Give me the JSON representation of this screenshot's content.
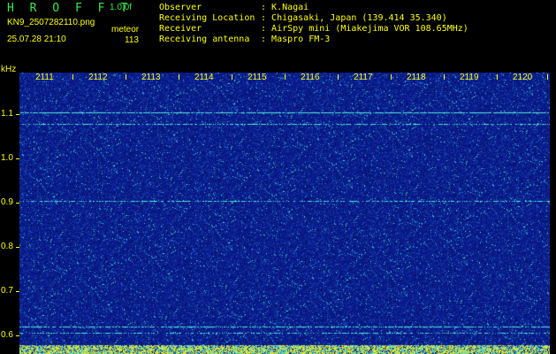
{
  "header": {
    "brand": "H R O F F T",
    "version": "1.0.0f",
    "filename": "KN9_2507282110.png",
    "mode": "meteor",
    "datetime": "25.07.28 21:10",
    "count": "113"
  },
  "info": [
    {
      "label": "Observer",
      "value": "K.Nagai"
    },
    {
      "label": "Receiving Location",
      "value": "Chigasaki, Japan (139.414 35.340)"
    },
    {
      "label": "Receiver",
      "value": "AirSpy mini (Miakejima VOR 108.65MHz)"
    },
    {
      "label": "Receiving antenna",
      "value": "Maspro FM-3"
    }
  ],
  "axis": {
    "unit": "kHz",
    "y_labels": [
      "1.1",
      "1.0",
      "0.9",
      "0.8",
      "0.7",
      "0.6"
    ],
    "x_labels": [
      "2111",
      "2112",
      "2113",
      "2114",
      "2115",
      "2116",
      "2117",
      "2118",
      "2119",
      "2120"
    ]
  },
  "colors": {
    "background": "#0a1a8a",
    "text": "#ffff00",
    "brand": "#39e84a",
    "signal": "#3fe6d0"
  }
}
